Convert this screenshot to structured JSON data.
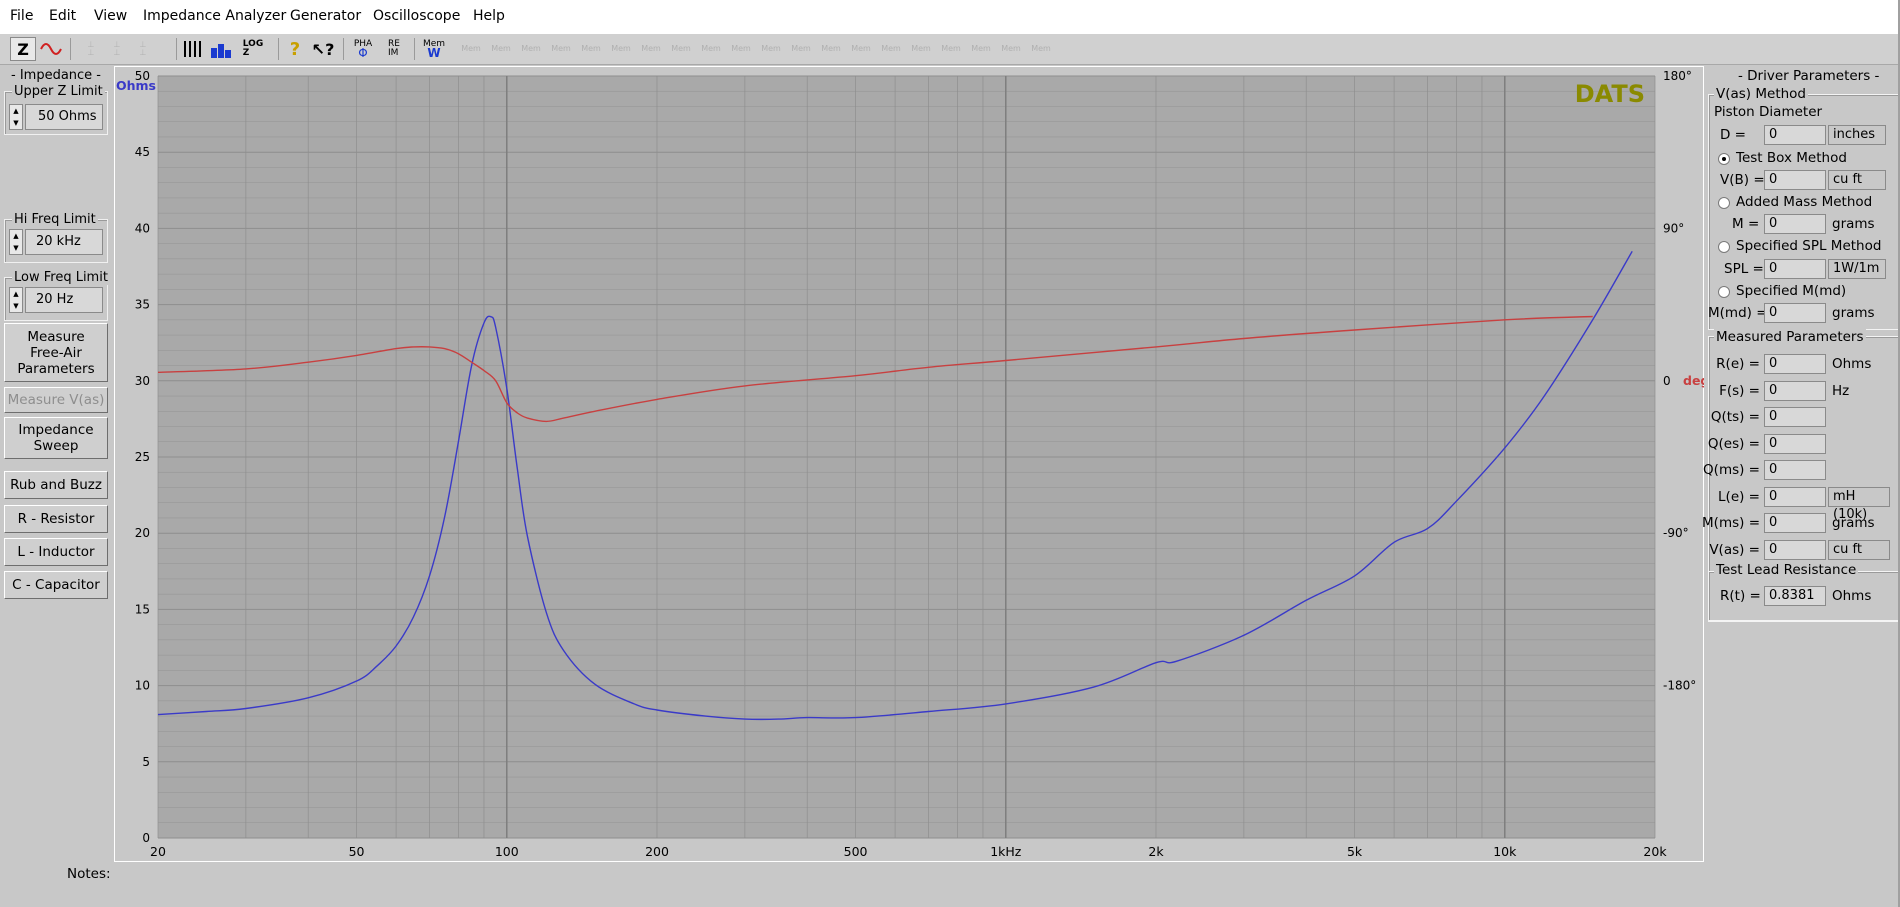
{
  "menu": [
    "File",
    "Edit",
    "View",
    "Impedance Analyzer",
    "Generator",
    "Oscilloscope",
    "Help"
  ],
  "toolbar": {
    "z_icon": "Z",
    "sine_icon": "sine-wave-icon",
    "loz_label": "LOG\nZ",
    "pha_label": "PHA",
    "reim_label": "RE\nIM",
    "mem_label": "Mem",
    "mem_slots": 20
  },
  "left": {
    "impedance_title": "- Impedance -",
    "upper_z_label": "Upper Z Limit",
    "upper_z_value": "50 Ohms",
    "hi_freq_label": "Hi Freq Limit",
    "hi_freq_value": "20 kHz",
    "low_freq_label": "Low Freq Limit",
    "low_freq_value": "20 Hz",
    "buttons": [
      {
        "label": "Measure\nFree-Air\nParameters",
        "enabled": true
      },
      {
        "label": "Measure V(as)",
        "enabled": false
      },
      {
        "label": "Impedance\nSweep",
        "enabled": true
      },
      {
        "label": "Rub and Buzz",
        "enabled": true
      },
      {
        "label": "R - Resistor",
        "enabled": true
      },
      {
        "label": "L - Inductor",
        "enabled": true
      },
      {
        "label": "C - Capacitor",
        "enabled": true
      }
    ]
  },
  "right": {
    "title": "- Driver Parameters -",
    "vas_method_label": "V(as) Method",
    "piston_label": "Piston Diameter",
    "d_label": "D =",
    "d_value": "0",
    "d_unit": "inches",
    "test_box_label": "Test Box Method",
    "vb_label": "V(B) =",
    "vb_value": "0",
    "vb_unit": "cu ft",
    "added_mass_label": "Added Mass Method",
    "m_label": "M =",
    "m_value": "0",
    "m_unit": "grams",
    "spl_method_label": "Specified SPL Method",
    "spl_label": "SPL =",
    "spl_value": "0",
    "spl_unit": "1W/1m",
    "mmd_method_label": "Specified M(md)",
    "mmd_label": "M(md) =",
    "mmd_value": "0",
    "mmd_unit": "grams",
    "measured_label": "Measured Parameters",
    "measured": [
      {
        "label": "R(e) =",
        "value": "0",
        "unit": "Ohms"
      },
      {
        "label": "F(s) =",
        "value": "0",
        "unit": "Hz"
      },
      {
        "label": "Q(ts) =",
        "value": "0",
        "unit": ""
      },
      {
        "label": "Q(es) =",
        "value": "0",
        "unit": ""
      },
      {
        "label": "Q(ms) =",
        "value": "0",
        "unit": ""
      },
      {
        "label": "L(e) =",
        "value": "0",
        "unit": "mH (10k)"
      },
      {
        "label": "M(ms) =",
        "value": "0",
        "unit": "grams"
      },
      {
        "label": "V(as) =",
        "value": "0",
        "unit": "cu ft"
      }
    ],
    "lead_label": "Test Lead Resistance",
    "rt_label": "R(t) =",
    "rt_value": "0.8381",
    "rt_unit": "Ohms"
  },
  "notes_label": "Notes:",
  "colors": {
    "plot_bg": "#a9a9a9",
    "grid": "#8e8e8e",
    "impedance": "#3a3ac8",
    "phase": "#c84040",
    "brand": "#8a8a00",
    "ohms_label": "#3a3ac8",
    "deg_label": "#c84040"
  },
  "chart_data": {
    "type": "line",
    "brand": "DATS",
    "ylabel": "Ohms",
    "y2label": "deg",
    "xscale": "log",
    "xlim": [
      20,
      20000
    ],
    "ylim": [
      0,
      50
    ],
    "y2lim": [
      -270,
      180
    ],
    "x_ticks": [
      {
        "v": 20,
        "l": "20"
      },
      {
        "v": 50,
        "l": "50"
      },
      {
        "v": 100,
        "l": "100"
      },
      {
        "v": 200,
        "l": "200"
      },
      {
        "v": 500,
        "l": "500"
      },
      {
        "v": 1000,
        "l": "1kHz"
      },
      {
        "v": 2000,
        "l": "2k"
      },
      {
        "v": 5000,
        "l": "5k"
      },
      {
        "v": 10000,
        "l": "10k"
      },
      {
        "v": 20000,
        "l": "20k"
      }
    ],
    "y_ticks": [
      0,
      5,
      10,
      15,
      20,
      25,
      30,
      35,
      40,
      45,
      50
    ],
    "y2_ticks": [
      {
        "v": 180,
        "l": "180°"
      },
      {
        "v": 90,
        "l": "90°"
      },
      {
        "v": 0,
        "l": "0"
      },
      {
        "v": -90,
        "l": "-90°"
      },
      {
        "v": -180,
        "l": "-180°"
      }
    ],
    "grid": true,
    "series": [
      {
        "key": "impedance",
        "axis": "left",
        "x": [
          20,
          25,
          30,
          40,
          50,
          55,
          60,
          65,
          70,
          75,
          80,
          85,
          90,
          93,
          95,
          100,
          105,
          110,
          120,
          130,
          150,
          180,
          200,
          250,
          300,
          350,
          400,
          500,
          700,
          1000,
          1500,
          2000,
          2200,
          3000,
          4000,
          5000,
          6000,
          7000,
          8000,
          10000,
          12000,
          15000,
          18000
        ],
        "y": [
          8.1,
          8.3,
          8.5,
          9.2,
          10.3,
          11.3,
          12.6,
          14.5,
          17.2,
          21.0,
          26.0,
          31.0,
          33.8,
          34.2,
          33.5,
          29.5,
          24.2,
          19.8,
          14.8,
          12.3,
          10.1,
          8.8,
          8.4,
          8.0,
          7.8,
          7.8,
          7.9,
          7.9,
          8.3,
          8.8,
          9.9,
          11.5,
          11.6,
          13.3,
          15.6,
          17.2,
          19.4,
          20.3,
          22.1,
          25.6,
          29.0,
          34.0,
          38.5
        ]
      },
      {
        "key": "phase",
        "axis": "right",
        "x": [
          20,
          30,
          40,
          50,
          60,
          65,
          70,
          75,
          80,
          85,
          90,
          95,
          100,
          105,
          110,
          120,
          130,
          150,
          200,
          300,
          500,
          700,
          1000,
          2000,
          3000,
          5000,
          10000,
          15000
        ],
        "y": [
          5,
          7,
          11,
          15,
          19,
          20,
          20,
          19,
          16,
          11,
          6,
          0,
          -13,
          -19,
          -22,
          -24,
          -22,
          -18,
          -11,
          -3,
          3,
          8,
          12,
          20,
          25,
          30,
          36,
          38
        ]
      }
    ]
  }
}
